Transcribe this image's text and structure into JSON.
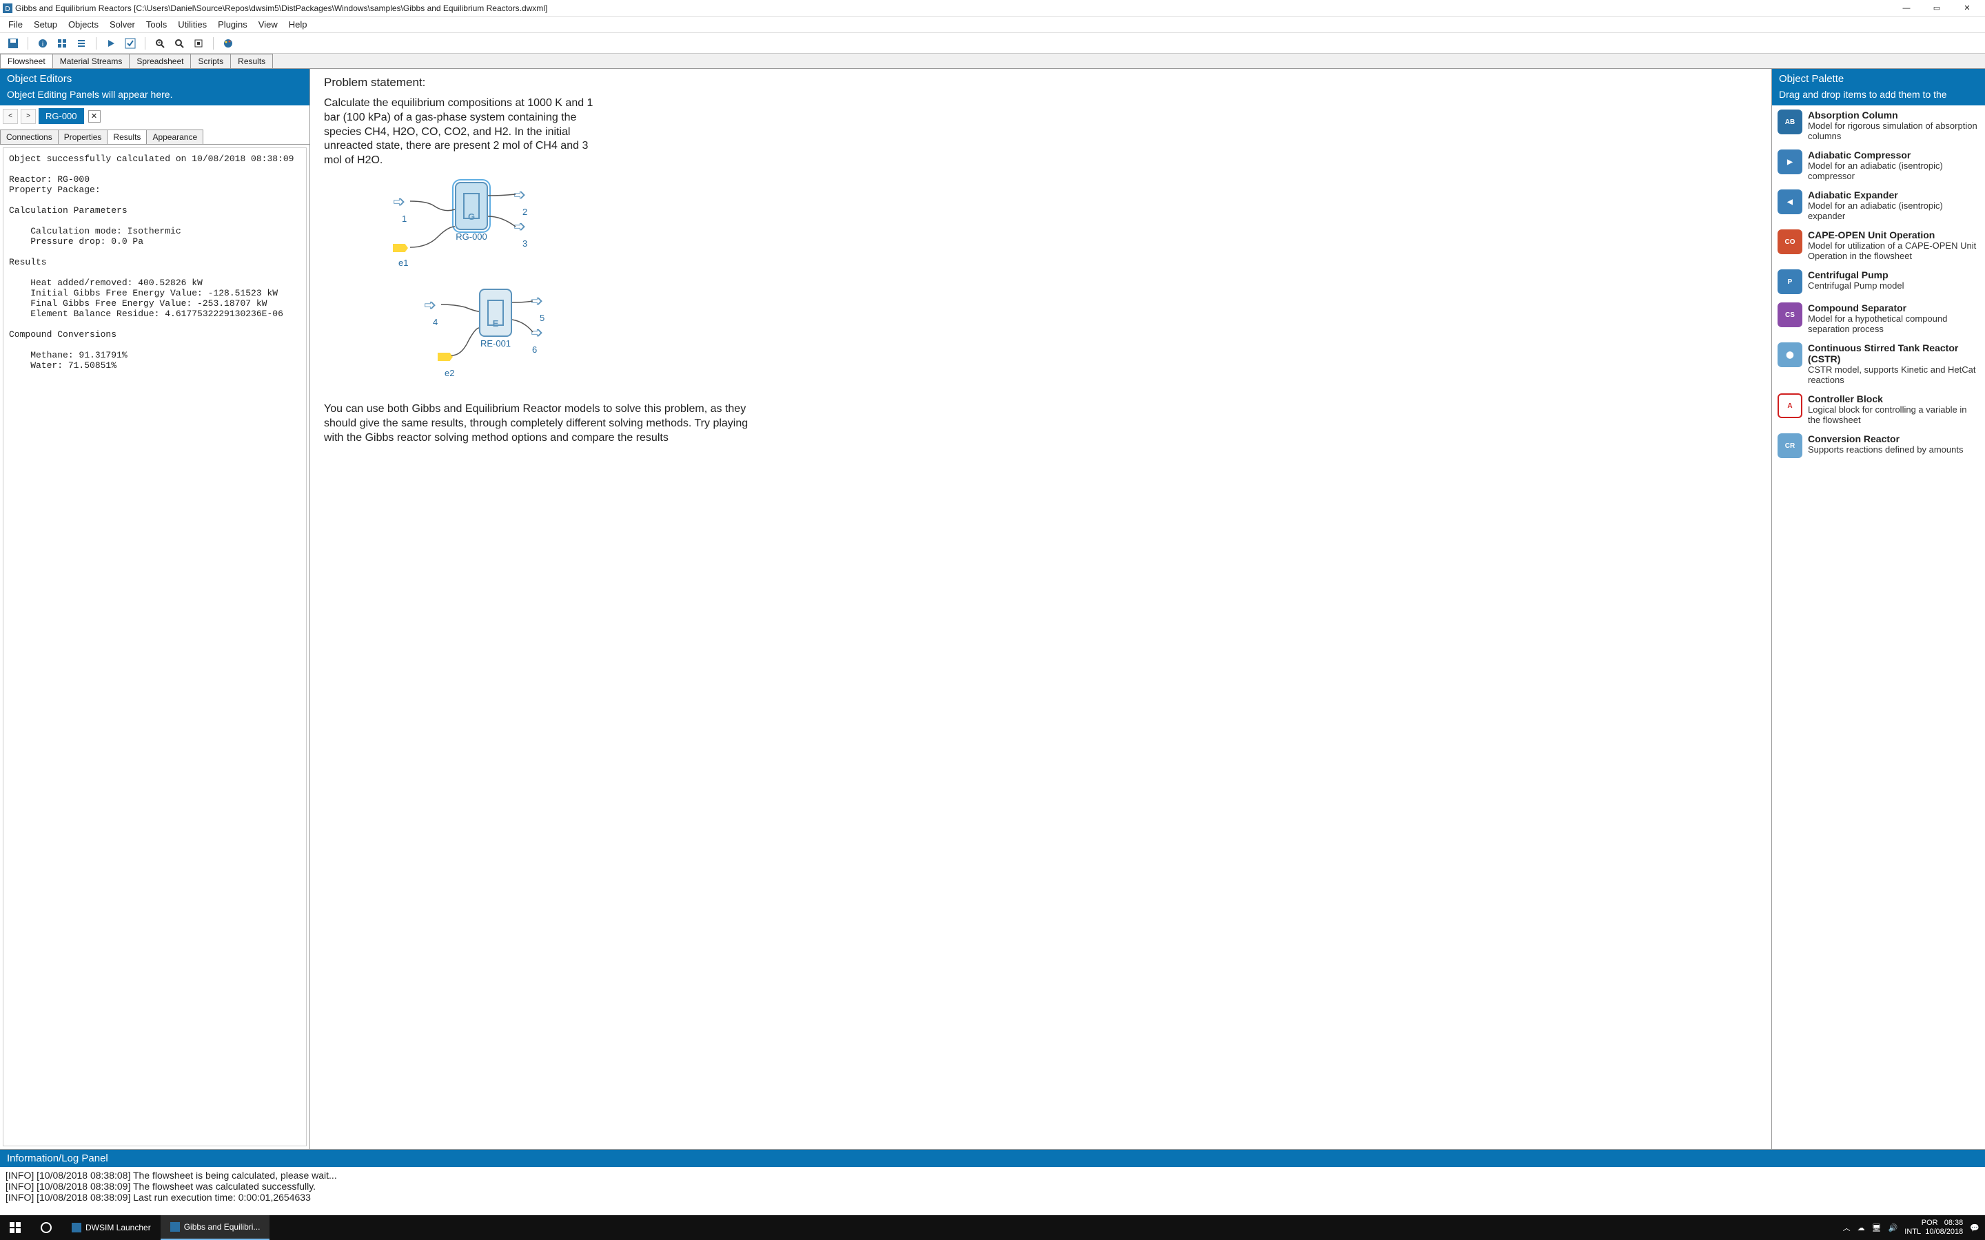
{
  "window": {
    "title": "Gibbs and Equilibrium Reactors [C:\\Users\\Daniel\\Source\\Repos\\dwsim5\\DistPackages\\Windows\\samples\\Gibbs and Equilibrium Reactors.dwxml]",
    "min": "—",
    "max": "▭",
    "close": "✕"
  },
  "menubar": [
    "File",
    "Setup",
    "Objects",
    "Solver",
    "Tools",
    "Utilities",
    "Plugins",
    "View",
    "Help"
  ],
  "maintabs": {
    "items": [
      "Flowsheet",
      "Material Streams",
      "Spreadsheet",
      "Scripts",
      "Results"
    ],
    "active": 0
  },
  "leftpanel": {
    "title": "Object Editors",
    "subtitle": "Object Editing Panels will appear here.",
    "nav_prev": "<",
    "nav_next": ">",
    "objtab": "RG-000",
    "objtab_close": "✕",
    "subtabs": {
      "items": [
        "Connections",
        "Properties",
        "Results",
        "Appearance"
      ],
      "active": 2
    },
    "results_text": "Object successfully calculated on 10/08/2018 08:38:09\n\nReactor: RG-000\nProperty Package:\n\nCalculation Parameters\n\n    Calculation mode: Isothermic\n    Pressure drop: 0.0 Pa\n\nResults\n\n    Heat added/removed: 400.52826 kW\n    Initial Gibbs Free Energy Value: -128.51523 kW\n    Final Gibbs Free Energy Value: -253.18707 kW\n    Element Balance Residue: 4.6177532229130236E-06\n\nCompound Conversions\n\n    Methane: 91.31791%\n    Water: 71.50851%"
  },
  "canvas": {
    "title": "Problem statement:",
    "para1": "Calculate the equilibrium compositions at 1000 K and 1 bar (100 kPa) of a gas-phase system containing the species CH4, H2O, CO, CO2, and H2. In the initial unreacted state, there are present 2 mol of CH4 and 3 mol of H2O.",
    "para2": "You can use both Gibbs and Equilibrium Reactor models to solve this problem, as they should give the same results, through completely different solving methods. Try playing with the Gibbs reactor solving method options and compare the results",
    "r1": {
      "label": "RG-000",
      "symbol": "G"
    },
    "r2": {
      "label": "RE-001",
      "symbol": "E"
    },
    "s": {
      "s1": "1",
      "s2": "2",
      "s3": "3",
      "s4": "4",
      "s5": "5",
      "s6": "6",
      "e1": "e1",
      "e2": "e2"
    }
  },
  "palette": {
    "title": "Object Palette",
    "subtitle": "Drag and drop items to add them to the",
    "items": [
      {
        "name": "Absorption Column",
        "desc": "Model for rigorous simulation of absorption columns",
        "icon": "AB",
        "bg": "#2a6fa3"
      },
      {
        "name": "Adiabatic Compressor",
        "desc": "Model for an adiabatic (isentropic) compressor",
        "icon": "▶",
        "bg": "#3a7fb8"
      },
      {
        "name": "Adiabatic Expander",
        "desc": "Model for an adiabatic (isentropic) expander",
        "icon": "◀",
        "bg": "#3a7fb8"
      },
      {
        "name": "CAPE-OPEN Unit Operation",
        "desc": "Model for utilization of a CAPE-OPEN Unit Operation in the flowsheet",
        "icon": "CO",
        "bg": "#d05030"
      },
      {
        "name": "Centrifugal Pump",
        "desc": "Centrifugal Pump model",
        "icon": "P",
        "bg": "#3a7fb8"
      },
      {
        "name": "Compound Separator",
        "desc": "Model for a hypothetical compound separation process",
        "icon": "CS",
        "bg": "#8a4ba8"
      },
      {
        "name": "Continuous Stirred Tank Reactor (CSTR)",
        "desc": "CSTR model, supports Kinetic and HetCat reactions",
        "icon": "⬤",
        "bg": "#6aa5d0"
      },
      {
        "name": "Controller Block",
        "desc": "Logical block for controlling a variable in the flowsheet",
        "icon": "A",
        "bg": "#fff"
      },
      {
        "name": "Conversion Reactor",
        "desc": "Supports reactions defined by amounts",
        "icon": "CR",
        "bg": "#6aa5d0"
      }
    ]
  },
  "log": {
    "title": "Information/Log Panel",
    "lines": [
      "[INFO] [10/08/2018 08:38:08] The flowsheet is being calculated, please wait...",
      "[INFO] [10/08/2018 08:38:09] The flowsheet was calculated successfully.",
      "[INFO] [10/08/2018 08:38:09] Last run execution time: 0:00:01,2654633"
    ]
  },
  "taskbar": {
    "app1": "DWSIM Launcher",
    "app2": "Gibbs and Equilibri...",
    "lang": "POR",
    "kbd": "INTL",
    "time": "08:38",
    "date": "10/08/2018"
  }
}
